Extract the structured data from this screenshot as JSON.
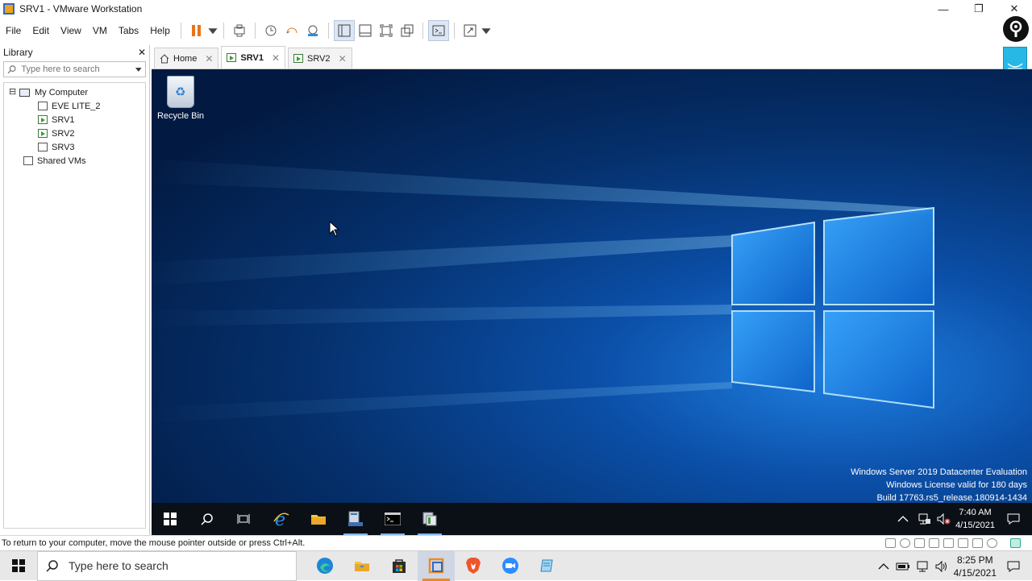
{
  "window": {
    "title": "SRV1 - VMware Workstation",
    "minimize": "—",
    "restore": "❐",
    "close": "✕"
  },
  "menu": [
    "File",
    "Edit",
    "View",
    "VM",
    "Tabs",
    "Help"
  ],
  "library": {
    "title": "Library",
    "close": "✕",
    "search_placeholder": "Type here to search",
    "tree": {
      "root": "My Computer",
      "root_expander": "⊟",
      "vms": [
        "EVE LITE_2",
        "SRV1",
        "SRV2",
        "SRV3"
      ],
      "running": [
        "SRV1",
        "SRV2"
      ],
      "shared": "Shared VMs"
    }
  },
  "tabs": [
    {
      "label": "Home",
      "icon": "home-icon"
    },
    {
      "label": "SRV1",
      "icon": "vm-running-icon",
      "active": true
    },
    {
      "label": "SRV2",
      "icon": "vm-running-icon"
    }
  ],
  "tab_close": "✕",
  "guest": {
    "desktop_icon": "Recycle Bin",
    "watermark": [
      "Windows Server 2019 Datacenter Evaluation",
      "Windows License valid for 180 days",
      "Build 17763.rs5_release.180914-1434"
    ],
    "clock_time": "7:40 AM",
    "clock_date": "4/15/2021"
  },
  "status": {
    "message": "To return to your computer, move the mouse pointer outside or press Ctrl+Alt."
  },
  "host": {
    "search_placeholder": "Type here to search",
    "clock_time": "8:25 PM",
    "clock_date": "4/15/2021"
  },
  "colors": {
    "accent": "#0a5bc4",
    "running_vm": "#3c9a3c",
    "vmware_orange": "#f08a1c"
  }
}
